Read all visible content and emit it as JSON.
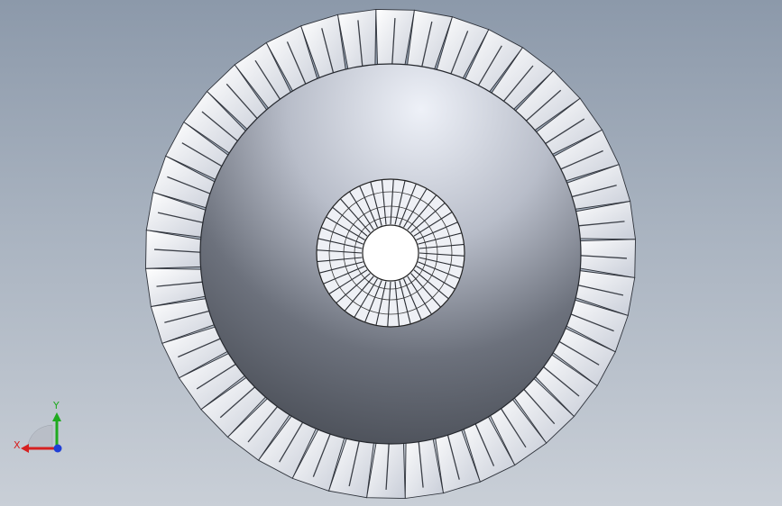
{
  "model": {
    "blade_count": 40,
    "hub_hole_slot_count": 40,
    "colors": {
      "blade_fill": "#d9dde6",
      "blade_edge": "#2e323a",
      "blade_slot": "#3b3f47",
      "disk_light": "#e4e8f2",
      "disk_dark": "#4a4e57",
      "hub_face": "#eef0f5",
      "bore": "#ffffff"
    }
  },
  "triad": {
    "x_label": "X",
    "y_label": "Y",
    "x_color": "#d62020",
    "y_color": "#1faa1f",
    "z_color": "#1f3fd6"
  }
}
